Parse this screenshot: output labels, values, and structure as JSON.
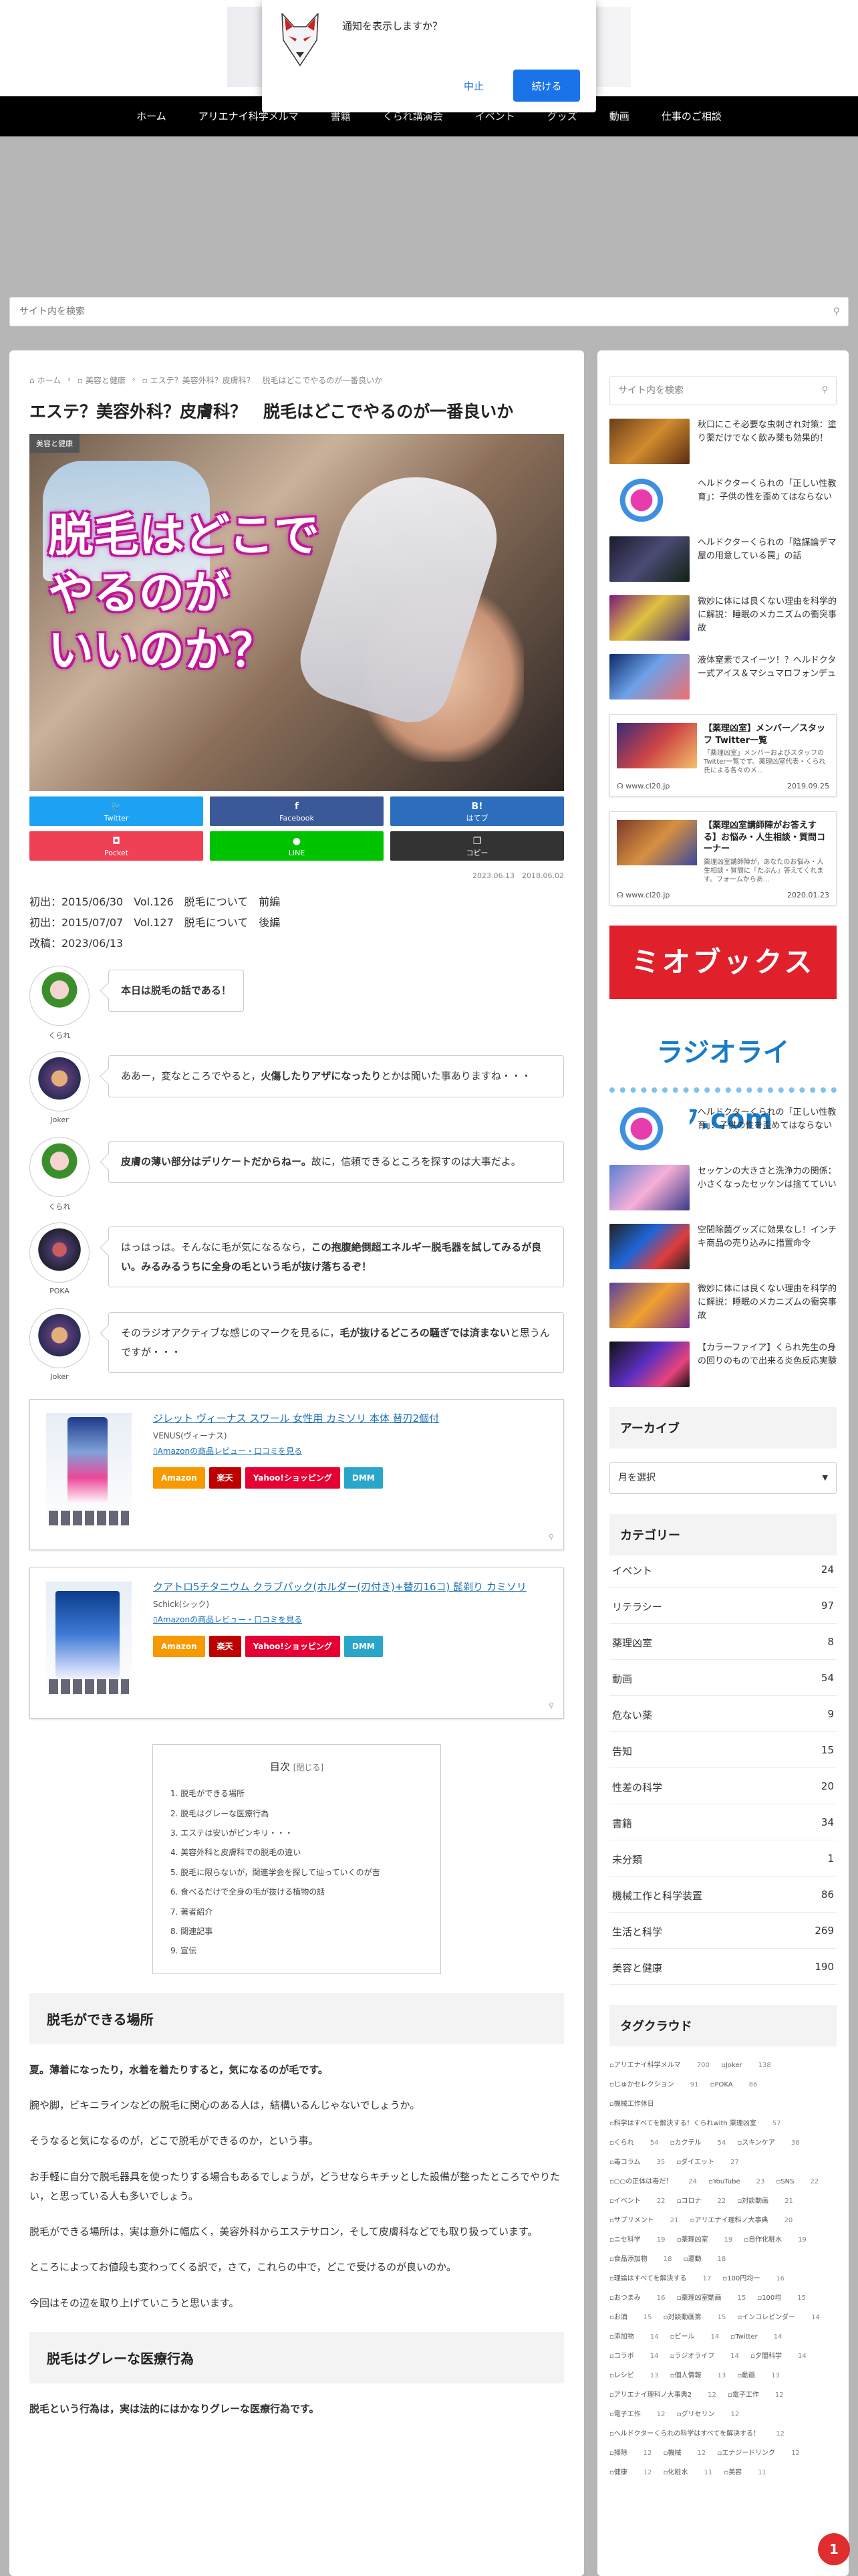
{
  "notification": {
    "title": "通知を表示しますか？",
    "deny_label": "中止",
    "allow_label": "続ける",
    "icon": "fox-mask-icon"
  },
  "nav": [
    "ホーム",
    "アリエナイ科学メルマ",
    "書籍",
    "くられ講演会",
    "イベント",
    "グッズ",
    "動画",
    "仕事のご相談"
  ],
  "search": {
    "placeholder": "サイト内を検索",
    "icon": "search-icon"
  },
  "breadcrumb": [
    "ホーム",
    "美容と健康",
    "エステ？美容外科？皮膚科？　脱毛はどこでやるのが一番良いか"
  ],
  "post": {
    "title": "エステ？美容外科？皮膚科？　脱毛はどこでやるのが一番良いか",
    "category_tag": "美容と健康",
    "eyecatch_text": "脱毛はどこで\nやるのが\nいいのか？",
    "dates": "2023.06.13　2018.06.02",
    "intro": "初出：2015/06/30　Vol.126　脱毛について　前編\n初出：2015/07/07　Vol.127　脱毛について　後編\n改稿：2023/06/13"
  },
  "share": {
    "twitter": "Twitter",
    "facebook": "Facebook",
    "hatena": "はてブ",
    "pocket": "Pocket",
    "line": "LINE",
    "copy": "コピー",
    "hatena_glyph": "B!"
  },
  "dialogue": [
    {
      "name": "くられ",
      "text_before": "",
      "bold": "本日は脱毛の話である！",
      "text_after": ""
    },
    {
      "name": "Joker",
      "text_before": "ああー，変なところでやると，",
      "bold": "火傷したりアザになったり",
      "text_after": "とかは聞いた事ありますね・・・"
    },
    {
      "name": "くられ",
      "text_before": "",
      "bold": "皮膚の薄い部分はデリケートだからねー。",
      "text_after": "故に，信頼できるところを探すのは大事だよ。"
    },
    {
      "name": "POKA",
      "text_before": "はっはっは。そんなに毛が気になるなら，",
      "bold": "この抱腹絶倒超エネルギー脱毛器を試してみるが良い。みるみるうちに全身の毛という毛が抜け落ちるぞ！",
      "text_after": ""
    },
    {
      "name": "Joker",
      "text_before": "そのラジオアクティブな感じのマークを見るに，",
      "bold": "毛が抜けるどころの騒ぎでは済まない",
      "text_after": "と思うんですが・・・"
    }
  ],
  "products": [
    {
      "title": "ジレット ヴィーナス スワール 女性用 カミソリ 本体 替刃2個付",
      "brand": "VENUS(ヴィーナス)",
      "review": "Amazonの商品レビュー・口コミを見る"
    },
    {
      "title": "クアトロ5チタニウム クラブパック(ホルダー(刃付き)+替刃16コ) 髭剃り カミソリ",
      "brand": "Schick(シック)",
      "review": "Amazonの商品レビュー・口コミを見る"
    }
  ],
  "shop_buttons": [
    "Amazon",
    "楽天",
    "Yahoo!ショッピング",
    "DMM"
  ],
  "toc": {
    "title": "目次",
    "toggle": "[閉じる]",
    "items": [
      "1. 脱毛ができる場所",
      "2. 脱毛はグレーな医療行為",
      "3. エステは安いがピンキリ・・・",
      "4. 美容外科と皮膚科での脱毛の違い",
      "5. 脱毛に限らないが，関連学会を探して辿っていくのが吉",
      "6. 食べるだけで全身の毛が抜ける植物の話",
      "7. 著者紹介",
      "8. 関連記事",
      "9. 宣伝"
    ]
  },
  "sections": [
    {
      "heading": "脱毛ができる場所",
      "paras": [
        {
          "b": "夏。薄着になったり，水着を着たりすると，気になるのが毛です。",
          "t": ""
        },
        {
          "b": "",
          "t": "腕や脚，ビキニラインなどの脱毛に関心のある人は，結構いるんじゃないでしょうか。"
        },
        {
          "b": "",
          "t": "そうなると気になるのが，どこで脱毛ができるのか，という事。"
        },
        {
          "b": "",
          "t": "お手軽に自分で脱毛器具を使ったりする場合もあるでしょうが，どうせならキチッとした設備が整ったところでやりたい，と思っている人も多いでしょう。"
        },
        {
          "b": "",
          "t": "脱毛ができる場所は，実は意外に幅広く，美容外科からエステサロン，そして皮膚科などでも取り扱っています。"
        },
        {
          "b": "",
          "t": "ところによってお値段も変わってくる訳で，さて，これらの中で，どこで受けるのが良いのか。"
        },
        {
          "b": "",
          "t": "今回はその辺を取り上げていこうと思います。"
        }
      ]
    },
    {
      "heading": "脱毛はグレーな医療行為",
      "paras": [
        {
          "b": "脱毛という行為は，実は法的にはかなりグレーな医療行為です。",
          "t": ""
        }
      ]
    }
  ],
  "sidebar": {
    "posts_top": [
      "秋口にこそ必要な虫刺され対策：塗り薬だけでなく飲み薬も効果的！",
      "ヘルドクターくられの「正しい性教育」：子供の性を歪めてはならない",
      "ヘルドクターくられの「陰謀論デマ屋の用意している罠」の話",
      "微妙に体には良くない理由を科学的に解説：睡眠のメカニズムの衝突事故",
      "液体窒素でスイーツ！？ヘルドクター式アイス＆マシュマロフォンデュ"
    ],
    "cards": [
      {
        "title": "【薬理凶室】メンバー／スタッフ Twitter一覧",
        "snippet": "「薬理凶室」メンバーおよびスタッフのTwitter一覧です。薬理凶室代表・くられ氏による各々のメ...",
        "site": "www.cl20.jp",
        "date": "2019.09.25"
      },
      {
        "title": "【薬理凶室講師陣がお答えする】お悩み・人生相談・質問コーナー",
        "snippet": "薬理凶室講師陣が，あなたのお悩み・人生相談・質問に「たぶん」答えてくれます。フォームからあ...",
        "site": "www.cl20.jp",
        "date": "2020.01.23"
      }
    ],
    "banner_mio": "ミオブックス",
    "banner_radio": "ラジオライフ.com",
    "posts_bottom": [
      "ヘルドクターくられの「正しい性教育」：子供の性を歪めてはならない",
      "セッケンの大きさと洗浄力の関係：小さくなったセッケンは捨てていい",
      "空間除菌グッズに効果なし！インチキ商品の売り込みに措置命令",
      "微妙に体には良くない理由を科学的に解説：睡眠のメカニズムの衝突事故",
      "【カラーファイア】くられ先生の身の回りのもので出来る炎色反応実験"
    ],
    "archive_title": "アーカイブ",
    "archive_select": "月を選択",
    "category_title": "カテゴリー",
    "categories": [
      {
        "name": "イベント",
        "count": "24"
      },
      {
        "name": "リテラシー",
        "count": "97"
      },
      {
        "name": "薬理凶室",
        "count": "8"
      },
      {
        "name": "動画",
        "count": "54"
      },
      {
        "name": "危ない薬",
        "count": "9"
      },
      {
        "name": "告知",
        "count": "15"
      },
      {
        "name": "性差の科学",
        "count": "20"
      },
      {
        "name": "書籍",
        "count": "34"
      },
      {
        "name": "未分類",
        "count": "1"
      },
      {
        "name": "機械工作と科学装置",
        "count": "86"
      },
      {
        "name": "生活と科学",
        "count": "269"
      },
      {
        "name": "美容と健康",
        "count": "190"
      }
    ],
    "tag_title": "タグクラウド",
    "tags": [
      {
        "name": "アリエナイ科学メルマ",
        "count": "700"
      },
      {
        "name": "Joker",
        "count": "138"
      },
      {
        "name": "じゅかセレクション",
        "count": "91"
      },
      {
        "name": "POKA",
        "count": "86"
      },
      {
        "name": "機械工作休日",
        "count": ""
      },
      {
        "name": "科学はすべてを解決する！くられwith 薬理凶室",
        "count": "57"
      },
      {
        "name": "くられ",
        "count": "54"
      },
      {
        "name": "カクテル",
        "count": "54"
      },
      {
        "name": "スキンケア",
        "count": "36"
      },
      {
        "name": "毒コラム",
        "count": "35"
      },
      {
        "name": "ダイエット",
        "count": "27"
      },
      {
        "name": "○○の正体は毒だ！",
        "count": "24"
      },
      {
        "name": "YouTube",
        "count": "23"
      },
      {
        "name": "SNS",
        "count": "22"
      },
      {
        "name": "イベント",
        "count": "22"
      },
      {
        "name": "コロナ",
        "count": "22"
      },
      {
        "name": "対談動画",
        "count": "21"
      },
      {
        "name": "サプリメント",
        "count": "21"
      },
      {
        "name": "アリエナイ理科ノ大事典",
        "count": "20"
      },
      {
        "name": "ニセ科学",
        "count": "19"
      },
      {
        "name": "薬理凶室",
        "count": "19"
      },
      {
        "name": "自作化粧水",
        "count": "19"
      },
      {
        "name": "食品添加物",
        "count": "18"
      },
      {
        "name": "運動",
        "count": "18"
      },
      {
        "name": "理論はすべてを解決する",
        "count": "17"
      },
      {
        "name": "100円均一",
        "count": "16"
      },
      {
        "name": "おつまみ",
        "count": "16"
      },
      {
        "name": "薬理凶室動画",
        "count": "15"
      },
      {
        "name": "100均",
        "count": "15"
      },
      {
        "name": "お酒",
        "count": "15"
      },
      {
        "name": "対談動画第",
        "count": "15"
      },
      {
        "name": "インコレビンダー",
        "count": "14"
      },
      {
        "name": "添加物",
        "count": "14"
      },
      {
        "name": "ビール",
        "count": "14"
      },
      {
        "name": "Twitter",
        "count": "14"
      },
      {
        "name": "コラボ",
        "count": "14"
      },
      {
        "name": "ラジオライフ",
        "count": "14"
      },
      {
        "name": "夕闇科学",
        "count": "14"
      },
      {
        "name": "レシピ",
        "count": "13"
      },
      {
        "name": "個人情報",
        "count": "13"
      },
      {
        "name": "動画",
        "count": "13"
      },
      {
        "name": "アリエナイ理科ノ大事典2",
        "count": "12"
      },
      {
        "name": "電子工作",
        "count": "12"
      },
      {
        "name": "電子工作",
        "count": "12"
      },
      {
        "name": "グリセリン",
        "count": "12"
      },
      {
        "name": "ヘルドクターくられの科学はすべてを解決する！",
        "count": "12"
      },
      {
        "name": "掃除",
        "count": "12"
      },
      {
        "name": "機械",
        "count": "12"
      },
      {
        "name": "エナジードリンク",
        "count": "12"
      },
      {
        "name": "健康",
        "count": "12"
      },
      {
        "name": "化粧水",
        "count": "11"
      },
      {
        "name": "美容",
        "count": "11"
      }
    ]
  },
  "chat_badge": "1"
}
